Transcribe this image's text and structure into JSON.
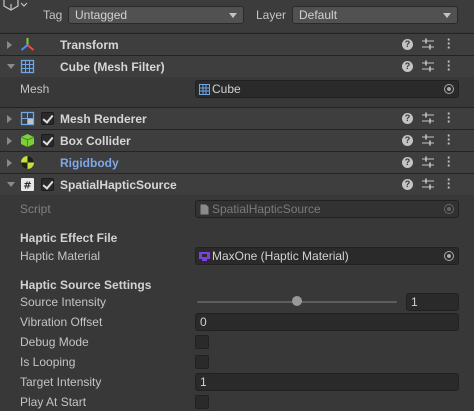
{
  "header": {
    "tag_label": "Tag",
    "tag_value": "Untagged",
    "layer_label": "Layer",
    "layer_value": "Default"
  },
  "components": {
    "transform": {
      "title": "Transform",
      "icon": "transform-axes-icon"
    },
    "mesh_filter": {
      "title": "Cube (Mesh Filter)",
      "icon": "mesh-grid-icon",
      "mesh_label": "Mesh",
      "mesh_value": "Cube"
    },
    "mesh_renderer": {
      "title": "Mesh Renderer",
      "icon": "mesh-renderer-icon",
      "enabled": true
    },
    "box_collider": {
      "title": "Box Collider",
      "icon": "box-collider-icon",
      "enabled": true
    },
    "rigidbody": {
      "title": "Rigidbody",
      "icon": "rigidbody-icon"
    },
    "spatial_haptic_source": {
      "title": "SpatialHapticSource",
      "icon": "script-hash-icon",
      "enabled": true,
      "script_label": "Script",
      "script_value": "SpatialHapticSource",
      "section_effect": "Haptic Effect File",
      "haptic_material_label": "Haptic Material",
      "haptic_material_value": "MaxOne (Haptic Material)",
      "section_settings": "Haptic Source Settings",
      "source_intensity_label": "Source Intensity",
      "source_intensity_value": "1",
      "source_intensity_slider_fraction": 0.5,
      "vibration_offset_label": "Vibration Offset",
      "vibration_offset_value": "0",
      "debug_mode_label": "Debug Mode",
      "debug_mode": false,
      "is_looping_label": "Is Looping",
      "is_looping": false,
      "target_intensity_label": "Target Intensity",
      "target_intensity_value": "1",
      "play_at_start_label": "Play At Start",
      "play_at_start": false
    }
  },
  "colors": {
    "background": "#383838",
    "header": "#3e3e3e",
    "field": "#2a2a2a",
    "rigidbody_title": "#7fa8ea",
    "haptic_icon": "#7b3fe4"
  }
}
